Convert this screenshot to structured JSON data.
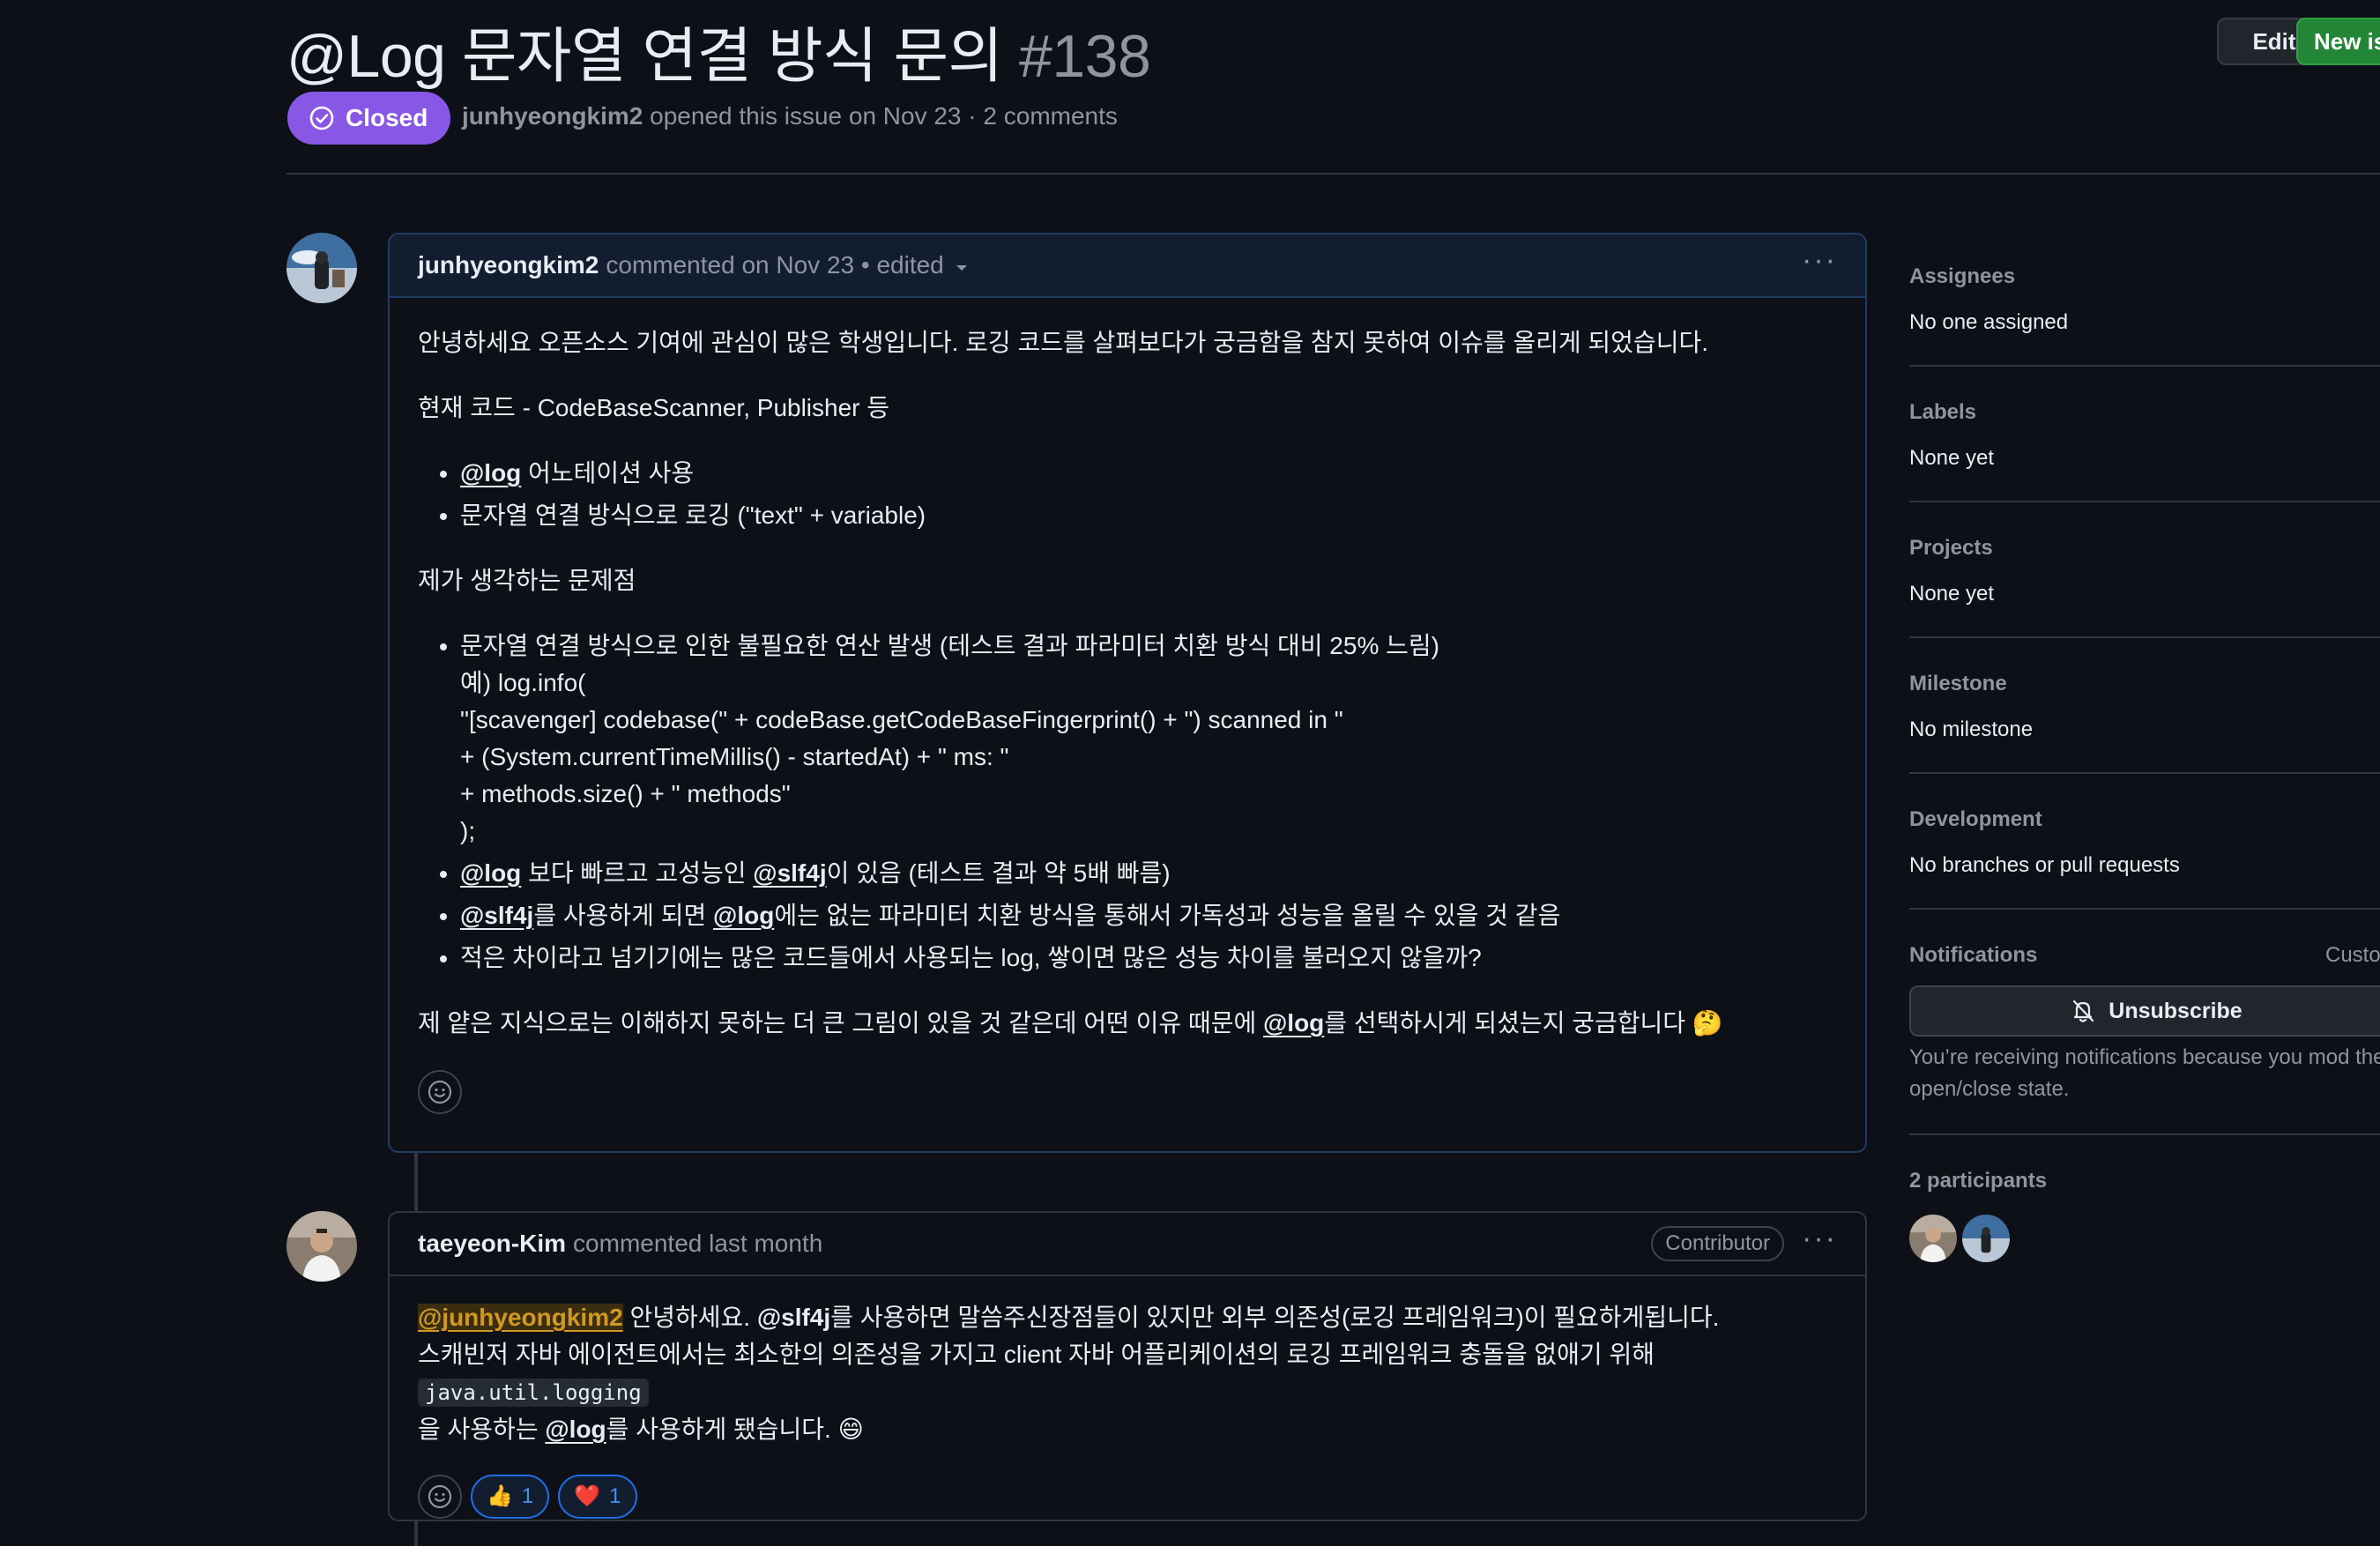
{
  "issue": {
    "title": "@Log 문자열 연결 방식 문의",
    "number": "#138",
    "state": "Closed",
    "author": "junhyeongkim2",
    "meta": "opened this issue on Nov 23 · 2 comments",
    "edit_label": "Edit",
    "new_label": "New is"
  },
  "comments": [
    {
      "author": "junhyeongkim2",
      "meta": "commented on Nov 23 •",
      "edited": "edited",
      "body": {
        "p1": "안녕하세요 오픈소스 기여에 관심이 많은 학생입니다. 로깅 코드를 살펴보다가 궁금함을 참지 못하여 이슈를 올리게 되었습니다.",
        "p2": "현재 코드 - CodeBaseScanner, Publisher 등",
        "list1": [
          {
            "mention": "@log",
            "text": " 어노테이션 사용"
          },
          {
            "text": "문자열 연결 방식으로 로깅 (\"text\" + variable)"
          }
        ],
        "p3": "제가 생각하는 문제점",
        "list2_item1": [
          "문자열 연결 방식으로 인한 불필요한 연산 발생 (테스트 결과 파라미터 치환 방식 대비 25% 느림)",
          "예) log.info(",
          "\"[scavenger] codebase(\" + codeBase.getCodeBaseFingerprint() + \") scanned in \"",
          "+ (System.currentTimeMillis() - startedAt) + \" ms: \"",
          "+ methods.size() + \" methods\"",
          ");"
        ],
        "list2_item2": {
          "m1": "@log",
          "t1": " 보다 빠르고 고성능인 ",
          "m2": "@slf4j",
          "t2": "이 있음 (테스트 결과 약 5배 빠름)"
        },
        "list2_item3": {
          "m1": "@slf4j",
          "t1": "를 사용하게 되면 ",
          "m2": "@log",
          "t2": "에는 없는 파라미터 치환 방식을 통해서 가독성과 성능을 올릴 수 있을 것 같음"
        },
        "list2_item4": "적은 차이라고 넘기기에는 많은 코드들에서 사용되는 log, 쌓이면 많은 성능 차이를 불러오지 않을까?",
        "p4": {
          "t1": "제 얕은 지식으로는 이해하지 못하는 더 큰 그림이 있을 것 같은데 어떤 이유 때문에 ",
          "m1": "@log",
          "t2": "를 선택하시게 되셨는지 궁금합니다 ",
          "emoji": "🤔"
        }
      }
    },
    {
      "author": "taeyeon-Kim",
      "meta": "commented last month",
      "role": "Contributor",
      "body": {
        "m0": "@junhyeongkim2",
        "t0": " 안녕하세요. ",
        "m1": "@slf4j",
        "t1": "를 사용하면 말씀주신장점들이 있지만 외부 의존성(로깅 프레임워크)이 필요하게됩니다.",
        "t2": "스캐빈저 자바 에이전트에서는 최소한의 의존성을 가지고 client 자바 어플리케이션의 로깅 프레임워크 충돌을 없애기 위해 ",
        "code": "java.util.logging",
        "t3": "을 사용하는 ",
        "m2": "@log",
        "t4": "를 사용하게 됐습니다. ",
        "emoji": "😄"
      },
      "reactions": [
        {
          "emoji": "👍",
          "count": "1"
        },
        {
          "emoji": "❤️",
          "count": "1"
        }
      ]
    }
  ],
  "sidebar": {
    "assignees_label": "Assignees",
    "assignees_value": "No one assigned",
    "labels_label": "Labels",
    "labels_value": "None yet",
    "projects_label": "Projects",
    "projects_value": "None yet",
    "milestone_label": "Milestone",
    "milestone_value": "No milestone",
    "development_label": "Development",
    "development_value": "No branches or pull requests",
    "notifications_label": "Notifications",
    "customize_label": "Custo",
    "unsubscribe_label": "Unsubscribe",
    "notif_text": "You’re receiving notifications because you mod the open/close state.",
    "participants_label": "2 participants"
  },
  "colors": {
    "background": "#0d1117",
    "closed_badge": "#8957e5",
    "new_button": "#238636",
    "mention_highlight": "#d29922",
    "reaction_border": "#1f6feb"
  }
}
